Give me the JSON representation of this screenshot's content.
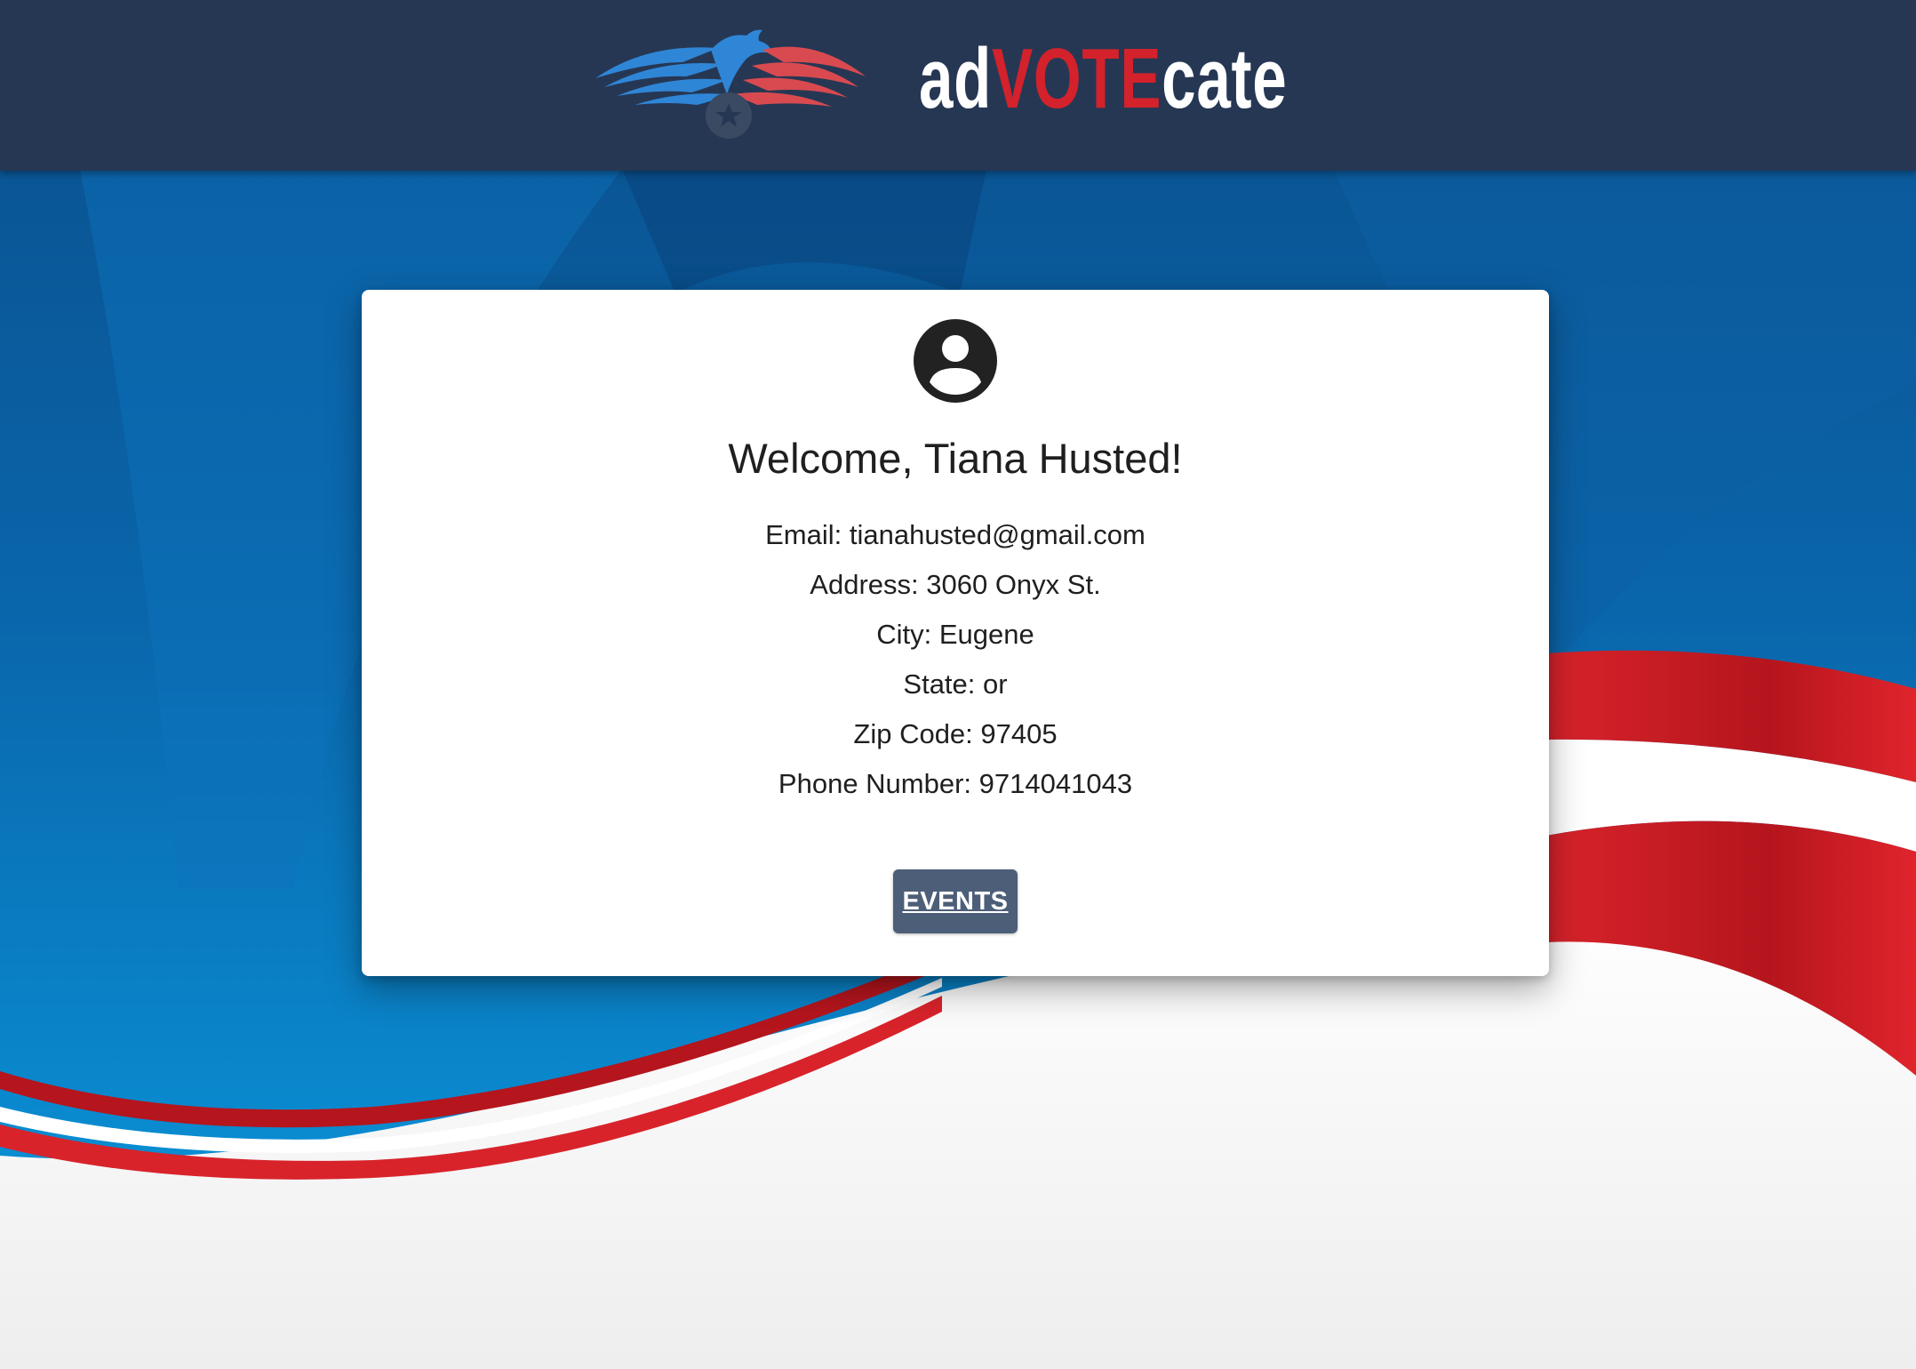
{
  "header": {
    "brand_prefix": "ad",
    "brand_highlight": "VOTE",
    "brand_suffix": "cate",
    "logo_icon": "eagle-star-logo-icon"
  },
  "profile": {
    "avatar_icon": "account-circle-icon",
    "welcome": "Welcome, Tiana Husted!",
    "details": [
      "Email: tianahusted@gmail.com",
      "Address: 3060 Onyx St.",
      "City: Eugene",
      "State: or",
      "Zip Code: 97405",
      "Phone Number: 9714041043"
    ],
    "events_button": "EVENTS"
  },
  "colors": {
    "header_bg": "#263754",
    "brand_red": "#d3222b",
    "background_blue": "#0a6bb0",
    "ribbon_red": "#c8151d",
    "button_bg": "#4d5e78"
  }
}
